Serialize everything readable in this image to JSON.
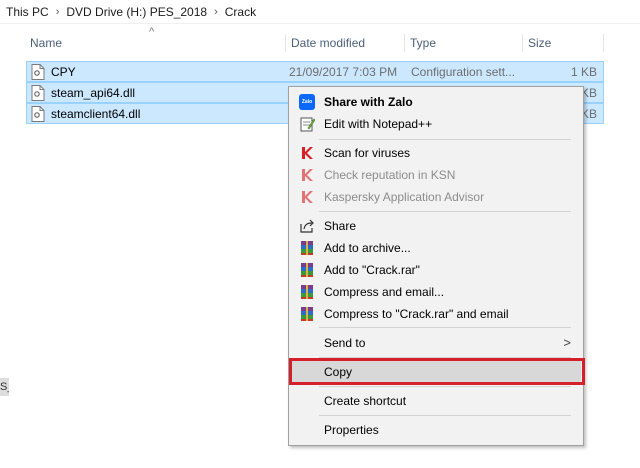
{
  "breadcrumb": {
    "items": [
      "This PC",
      "DVD Drive (H:) PES_2018",
      "Crack"
    ],
    "separator": "›"
  },
  "columns": {
    "name": "Name",
    "date_modified": "Date modified",
    "type": "Type",
    "size": "Size"
  },
  "files": [
    {
      "name": "CPY",
      "date": "21/09/2017 7:03 PM",
      "type": "Configuration sett...",
      "size": "1 KB"
    },
    {
      "name": "steam_api64.dll",
      "size": "KB"
    },
    {
      "name": "steamclient64.dll",
      "size": "KB"
    }
  ],
  "left_stub": "S_",
  "context_menu": {
    "share_with_zalo": "Share with Zalo",
    "zalo_icon_text": "Zalo",
    "edit_notepad": "Edit with Notepad++",
    "scan_viruses": "Scan for viruses",
    "check_reputation": "Check reputation in KSN",
    "kaspersky_advisor": "Kaspersky Application Advisor",
    "share": "Share",
    "add_archive": "Add to archive...",
    "add_crack_rar": "Add to \"Crack.rar\"",
    "compress_email": "Compress and email...",
    "compress_crack_email": "Compress to \"Crack.rar\" and email",
    "send_to": "Send to",
    "copy": "Copy",
    "create_shortcut": "Create shortcut",
    "properties": "Properties"
  },
  "colors": {
    "selection": "#cce8ff",
    "highlight_outline": "#d3202a",
    "kaspersky_red": "#d71f26"
  }
}
